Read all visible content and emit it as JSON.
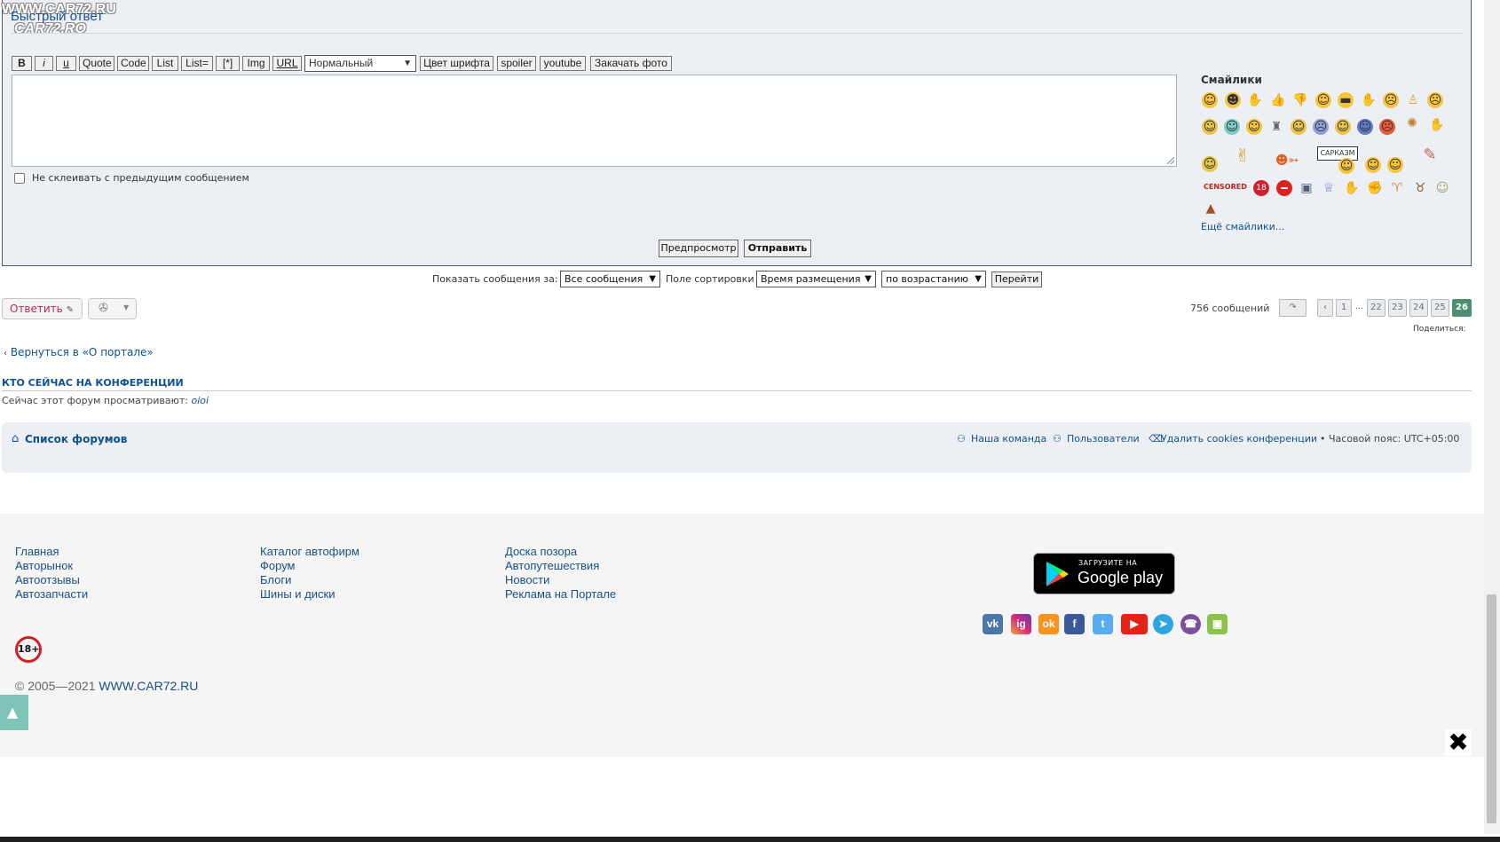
{
  "watermark": {
    "line1": "WWW.CAR72.RU",
    "line2": "CAR72.RO"
  },
  "quick_reply": {
    "title": "Быстрый ответ",
    "toolbar": {
      "bold": "B",
      "italic": "i",
      "underline": "u",
      "quote": "Quote",
      "code": "Code",
      "list": "List",
      "list_eq": "List=",
      "list_item": "[*]",
      "img": "Img",
      "url": "URL",
      "font_size": "Нормальный",
      "font_color": "Цвет шрифта",
      "spoiler": "spoiler",
      "youtube": "youtube",
      "upload_photo": "Закачать фото"
    },
    "textarea_value": "",
    "no_merge_label": "Не склеивать с предыдущим сообщением",
    "preview": "Предпросмотр",
    "submit": "Отправить"
  },
  "smilies": {
    "title": "Смайлики",
    "more": "Ещё смайлики...",
    "sarcasm_label": "САРКАЗМ",
    "censored_label": "CENSORED",
    "eighteen_label": "18"
  },
  "sort_bar": {
    "show_label": "Показать сообщения за:",
    "show_value": "Все сообщения",
    "sort_label": "Поле сортировки",
    "sort_value": "Время размещения",
    "order_value": "по возрастанию",
    "go": "Перейти"
  },
  "actions": {
    "reply": "Ответить",
    "post_count": "756 сообщений",
    "pages": [
      "1",
      "…",
      "22",
      "23",
      "24",
      "25",
      "26"
    ],
    "share": "Поделиться:"
  },
  "back_link": "Вернуться в «О портале»",
  "who": {
    "title": "КТО СЕЙЧАС НА КОНФЕРЕНЦИИ",
    "text": "Сейчас этот форум просматривают: ",
    "user": "oioi"
  },
  "nav_footer": {
    "forum_list": "Список форумов",
    "team": "Наша команда",
    "members": "Пользователи",
    "delete_cookies": "Удалить cookies конференции",
    "timezone": "• Часовой пояс: UTC+05:00"
  },
  "site_footer": {
    "col1": [
      "Главная",
      "Авторынок",
      "Автоотзывы",
      "Автозапчасти"
    ],
    "col2": [
      "Каталог автофирм",
      "Форум",
      "Блоги",
      "Шины и диски"
    ],
    "col3": [
      "Доска позора",
      "Автопутешествия",
      "Новости",
      "Реклама на Портале"
    ],
    "age": "18+",
    "copyright_prefix": "© 2005—2021 ",
    "copyright_site": "WWW.CAR72.RU",
    "gp_small": "ЗАГРУЗИТЕ НА",
    "gp_big": "Google play",
    "social": [
      "vk",
      "ig",
      "ok",
      "f",
      "t",
      "▶",
      "➤",
      "☎",
      "▣"
    ]
  },
  "colors": {
    "accent": "#105289",
    "reply": "#bc2a4d",
    "active_page": "#4c8f71"
  }
}
